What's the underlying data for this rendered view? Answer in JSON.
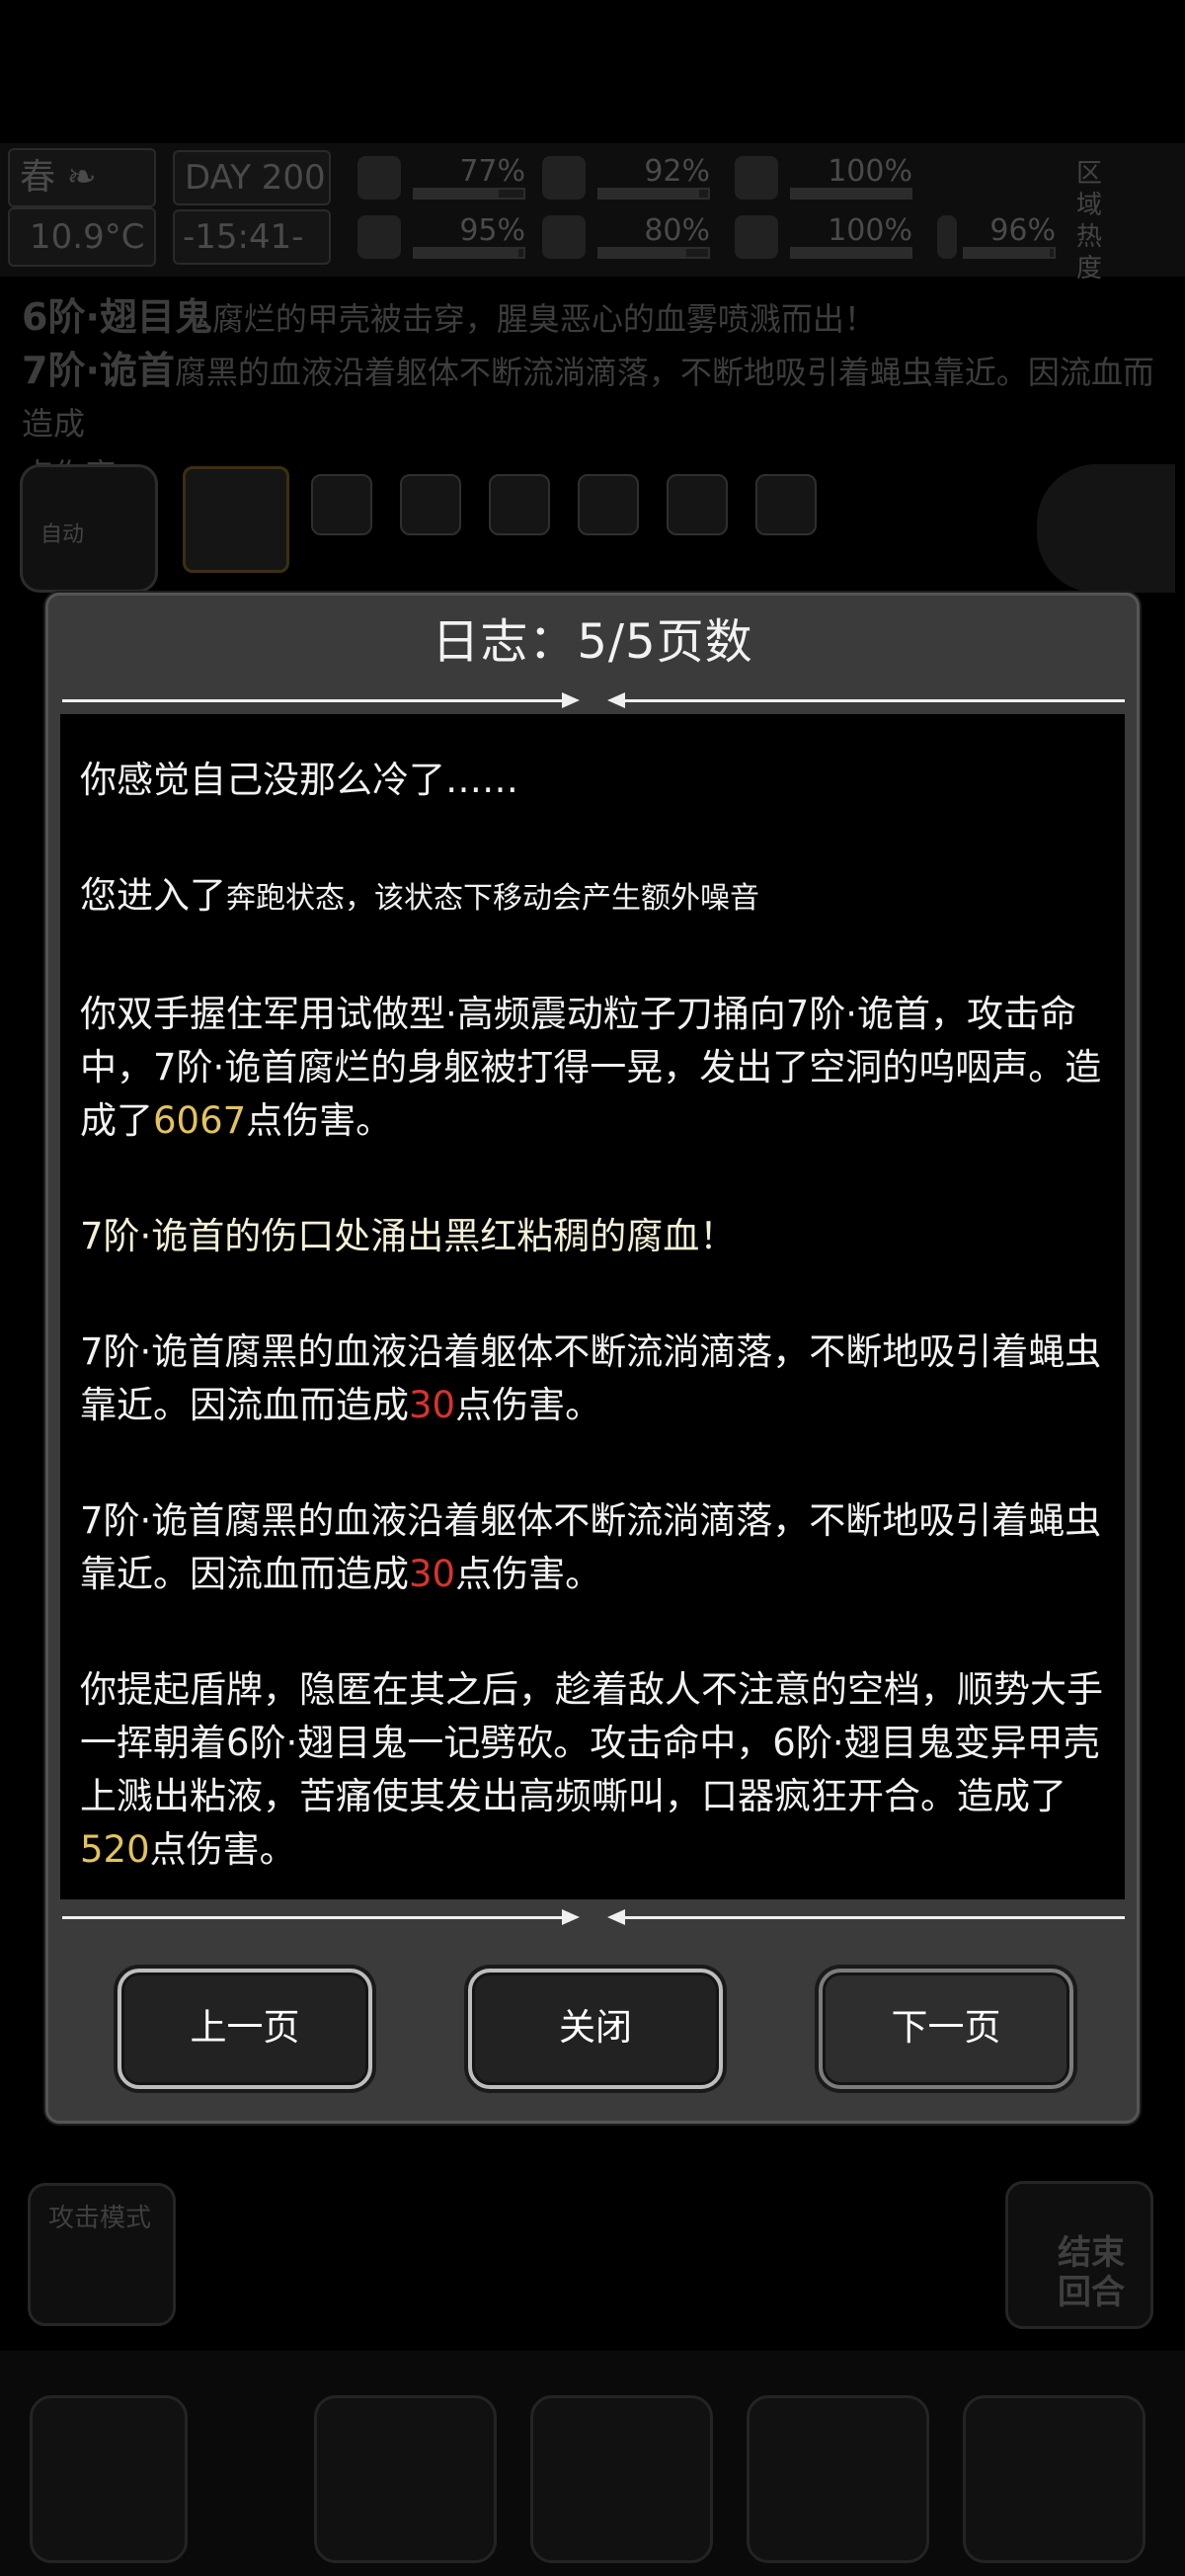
{
  "status": {
    "season": "春",
    "temperature": "10.9°C",
    "day_label": "DAY",
    "day_number": "200",
    "time": "-15:41-",
    "meters": [
      {
        "name": "health",
        "percent": "77%"
      },
      {
        "name": "hunger",
        "percent": "92%"
      },
      {
        "name": "thirst",
        "percent": "100%"
      },
      {
        "name": "sanity",
        "percent": "95%"
      },
      {
        "name": "water",
        "percent": "80%"
      },
      {
        "name": "mood",
        "percent": "100%"
      },
      {
        "name": "stamina",
        "percent": "96%"
      }
    ],
    "region_label": "区域热度"
  },
  "background_log": {
    "line1_name": "6阶·翅目鬼",
    "line1_text": "腐烂的甲壳被击穿，腥臭恶心的血雾喷溅而出！",
    "line2_name": "7阶·诡首",
    "line2_text": "腐黑的血液沿着躯体不断流淌滴落，不断地吸引着蝇虫靠近。因流血而造成",
    "line2_tail": "点伤害。"
  },
  "char_row": {
    "auto_label": "自动"
  },
  "dialog": {
    "title": "日志：5/5页数",
    "entries": [
      {
        "parts": [
          {
            "t": "你感觉自己没那么冷了……"
          }
        ]
      },
      {
        "parts": [
          {
            "t": "您进入了"
          },
          {
            "t": "奔跑状态，该状态下移动会产生额外噪音",
            "cls": "small"
          }
        ]
      },
      {
        "parts": [
          {
            "t": "你双手握住军用试做型·高频震动粒子刀捅向7阶·诡首，攻击命中，7阶·诡首腐烂的身躯被打得一晃，发出了空洞的呜咽声。造成了"
          },
          {
            "t": "6067",
            "cls": "gold"
          },
          {
            "t": "点伤害。"
          }
        ]
      },
      {
        "parts": [
          {
            "t": "7阶·诡首的伤口处涌出黑红粘稠的腐血！",
            "cls": "lite"
          }
        ]
      },
      {
        "parts": [
          {
            "t": "7阶·诡首腐黑的血液沿着躯体不断流淌滴落，不断地吸引着蝇虫靠近。因流血而造成"
          },
          {
            "t": "30",
            "cls": "red"
          },
          {
            "t": "点伤害。"
          }
        ]
      },
      {
        "parts": [
          {
            "t": "7阶·诡首腐黑的血液沿着躯体不断流淌滴落，不断地吸引着蝇虫靠近。因流血而造成"
          },
          {
            "t": "30",
            "cls": "red"
          },
          {
            "t": "点伤害。"
          }
        ]
      },
      {
        "parts": [
          {
            "t": "你提起盾牌，隐匿在其之后，趁着敌人不注意的空档，顺势大手一挥朝着6阶·翅目鬼一记劈砍。攻击命中，6阶·翅目鬼变异甲壳上溅出粘液，苦痛使其发出高频嘶叫，口器疯狂开合。造成了"
          },
          {
            "t": "520",
            "cls": "gold"
          },
          {
            "t": "点伤害。"
          }
        ]
      }
    ],
    "buttons": {
      "prev": "上一页",
      "close": "关闭",
      "next": "下一页"
    }
  },
  "bottom": {
    "attack_mode": "攻击模式",
    "end_turn": "结束回合"
  }
}
